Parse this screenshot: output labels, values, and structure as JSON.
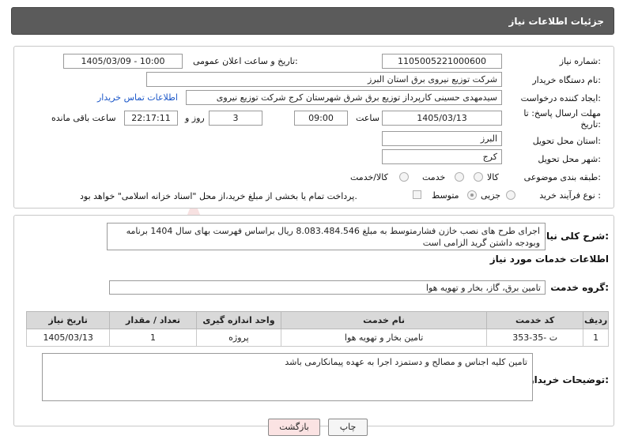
{
  "header": {
    "title": "جزئیات اطلاعات نیاز"
  },
  "form": {
    "need_number_label": "شماره نیاز:",
    "need_number": "1105005221000600",
    "announce_label": "تاریخ و ساعت اعلان عمومی:",
    "announce_value": "1405/03/09 - 10:00",
    "buyer_org_label": "نام دستگاه خریدار:",
    "buyer_org": "شرکت توزیع نیروی برق استان البرز",
    "creator_label": "ایجاد کننده درخواست:",
    "creator": "سیدمهدی حسینی کارپرداز توزیع برق شرق شهرستان کرج شرکت توزیع نیروی",
    "contact_link": "اطلاعات تماس خریدار",
    "deadline_label_1": "مهلت ارسال پاسخ: تا",
    "deadline_label_2": "تاریخ:",
    "deadline_date": "1405/03/13",
    "time_label": "ساعت",
    "deadline_time": "09:00",
    "days": "3",
    "days_label": "روز و",
    "remaining_time": "22:17:11",
    "remaining_label": "ساعت باقی مانده",
    "province_label": "استان محل تحویل:",
    "province": "البرز",
    "city_label": "شهر محل تحویل:",
    "city": "کرج",
    "category_label": "طبقه بندی موضوعی:",
    "category_options": [
      "کالا",
      "خدمت",
      "کالا/خدمت"
    ],
    "category_selected": "خدمت",
    "process_label": "نوع فرآیند خرید :",
    "process_options": [
      "جزیی",
      "متوسط"
    ],
    "process_selected": "متوسط",
    "payment_note": "پرداخت تمام یا بخشی از مبلغ خرید،از محل \"اسناد خزانه اسلامی\" خواهد بود."
  },
  "description": {
    "label": "شرح کلی نیاز:",
    "text": "اجرای طرح های نصب خازن فشارمتوسط به مبلغ 8.083.484.546 ریال براساس فهرست بهای سال 1404 برنامه وبودجه داشتن گرید الزامی است"
  },
  "services": {
    "section_title": "اطلاعات خدمات مورد نیاز",
    "group_label": "گروه خدمت:",
    "group_value": "تامین برق، گاز، بخار و تهویه هوا",
    "columns": [
      "ردیف",
      "کد خدمت",
      "نام خدمت",
      "واحد اندازه گیری",
      "تعداد / مقدار",
      "تاریخ نیاز"
    ],
    "rows": [
      {
        "row": "1",
        "code": "ت -35-353",
        "name": "تامین بخار و تهویه هوا",
        "unit": "پروژه",
        "qty": "1",
        "date": "1405/03/13"
      }
    ]
  },
  "buyer_notes": {
    "label": "توضیحات خریدار:",
    "text": "تامین کلیه اجناس و مصالح و دستمزد اجرا به عهده پیمانکارمی باشد"
  },
  "buttons": {
    "print": "چاپ",
    "back": "بازگشت"
  },
  "colors": {
    "header_bg": "#5b5b5b",
    "link": "#1a56c8",
    "back_button_bg": "#fbe3e3"
  }
}
